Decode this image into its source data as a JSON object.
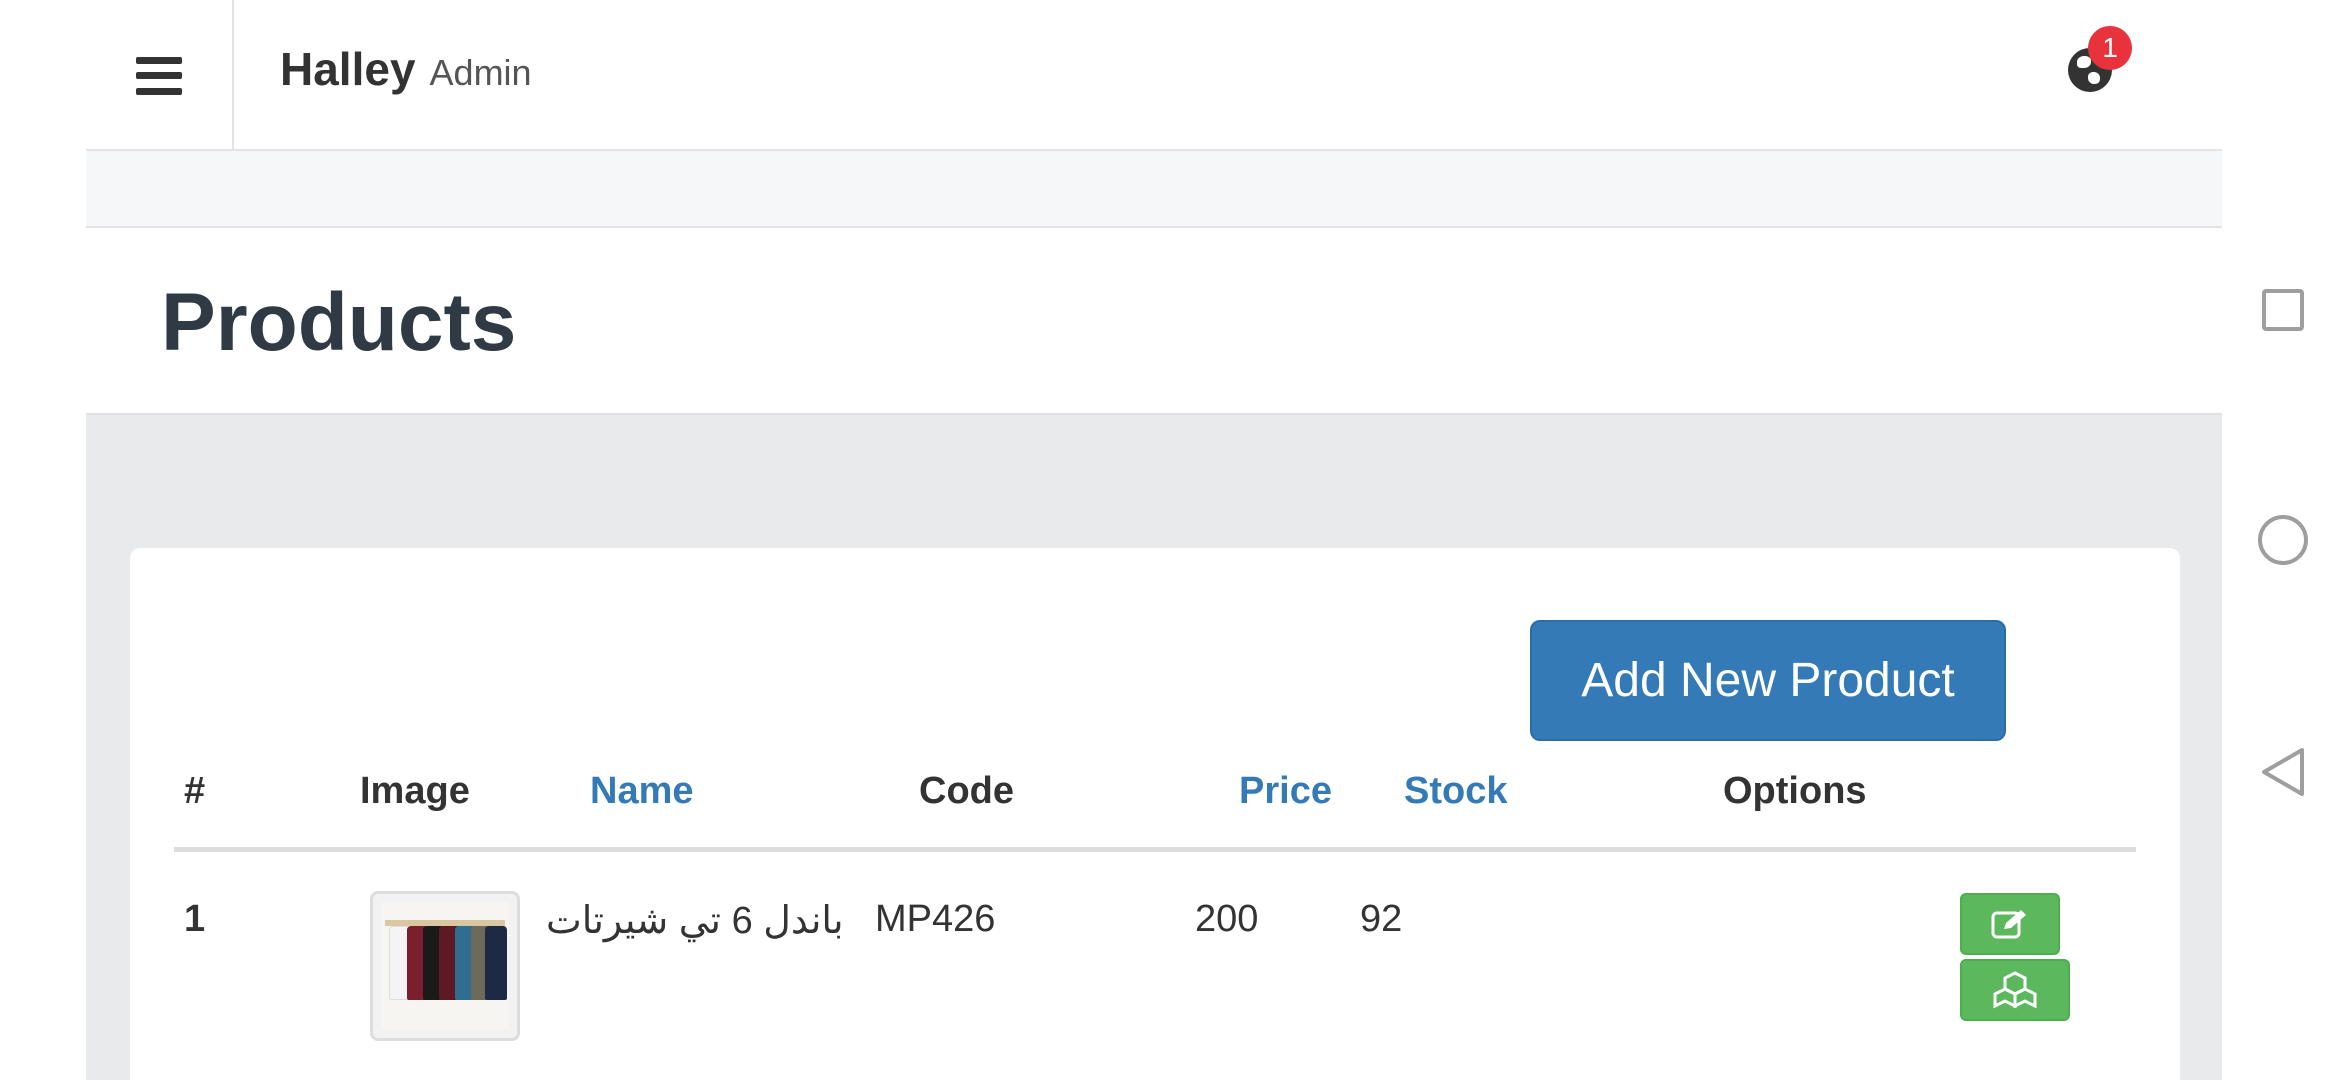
{
  "header": {
    "brand_name": "Halley",
    "brand_role": "Admin",
    "notification_count": "1"
  },
  "page": {
    "title": "Products"
  },
  "toolbar": {
    "add_label": "Add New Product"
  },
  "table": {
    "headers": {
      "index": "#",
      "image": "Image",
      "name": "Name",
      "code": "Code",
      "price": "Price",
      "stock": "Stock",
      "options": "Options"
    },
    "rows": [
      {
        "index": "1",
        "name": "باندل 6 تي شيرتات",
        "code": "MP426",
        "price": "200",
        "stock": "92"
      }
    ]
  },
  "colors": {
    "primary": "#337ab7",
    "success": "#5cb85c",
    "badge": "#e8323c"
  },
  "icons": {
    "menu": "hamburger-icon",
    "notifications": "globe-icon",
    "edit": "edit-icon",
    "stock": "cubes-icon",
    "recent_apps": "square-icon",
    "home": "circle-icon",
    "back": "triangle-back-icon"
  }
}
